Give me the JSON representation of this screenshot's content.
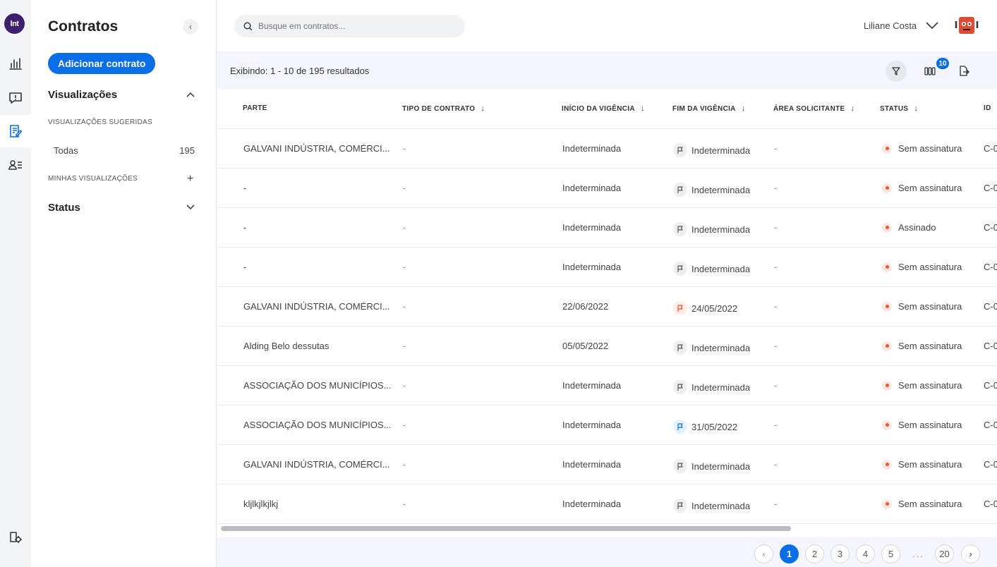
{
  "app": {
    "logo_text": "lnt"
  },
  "rail": {
    "items": [
      "chart-icon",
      "alert-icon",
      "contracts-icon",
      "users-icon",
      "settings-icon"
    ]
  },
  "sidebar": {
    "title": "Contratos",
    "add_button": "Adicionar contrato",
    "visualizacoes": "Visualizações",
    "sugeridas": "VISUALIZAÇÕES SUGERIDAS",
    "todas_label": "Todas",
    "todas_count": "195",
    "minhas": "MINHAS VISUALIZAÇÕES",
    "status": "Status"
  },
  "header": {
    "search_placeholder": "Busque em contratos...",
    "user_name": "Liliane Costa"
  },
  "toolbar": {
    "results_text": "Exibindo: 1 - 10 de 195 resultados",
    "columns_badge": "10"
  },
  "table": {
    "headers": [
      "PARTE",
      "TIPO DE CONTRATO",
      "INÍCIO DA VIGÊNCIA",
      "FIM DA VIGÊNCIA",
      "ÁREA SOLICITANTE",
      "STATUS",
      "ID"
    ],
    "rows": [
      {
        "parte": "GALVANI INDÚSTRIA, COMÉRCI...",
        "tipo": "-",
        "inicio": "Indeterminada",
        "fim": "Indeterminada",
        "fim_flag": "gray",
        "area": "-",
        "status": "Sem assinatura",
        "id": "C-0"
      },
      {
        "parte": "-",
        "tipo": "-",
        "inicio": "Indeterminada",
        "fim": "Indeterminada",
        "fim_flag": "gray",
        "area": "-",
        "status": "Sem assinatura",
        "id": "C-0"
      },
      {
        "parte": "-",
        "tipo": "-",
        "inicio": "Indeterminada",
        "fim": "Indeterminada",
        "fim_flag": "gray",
        "area": "-",
        "status": "Assinado",
        "id": "C-0"
      },
      {
        "parte": "-",
        "tipo": "-",
        "inicio": "Indeterminada",
        "fim": "Indeterminada",
        "fim_flag": "gray",
        "area": "-",
        "status": "Sem assinatura",
        "id": "C-0"
      },
      {
        "parte": "GALVANI INDÚSTRIA, COMÉRCI...",
        "tipo": "-",
        "inicio": "22/06/2022",
        "fim": "24/05/2022",
        "fim_flag": "red",
        "area": "-",
        "status": "Sem assinatura",
        "id": "C-0"
      },
      {
        "parte": "Alding Belo dessutas",
        "tipo": "-",
        "inicio": "05/05/2022",
        "fim": "Indeterminada",
        "fim_flag": "gray",
        "area": "-",
        "status": "Sem assinatura",
        "id": "C-0"
      },
      {
        "parte": "ASSOCIAÇÃO DOS MUNICÍPIOS...",
        "tipo": "-",
        "inicio": "Indeterminada",
        "fim": "Indeterminada",
        "fim_flag": "gray",
        "area": "-",
        "status": "Sem assinatura",
        "id": "C-0"
      },
      {
        "parte": "ASSOCIAÇÃO DOS MUNICÍPIOS...",
        "tipo": "-",
        "inicio": "Indeterminada",
        "fim": "31/05/2022",
        "fim_flag": "blue",
        "area": "-",
        "status": "Sem assinatura",
        "id": "C-0"
      },
      {
        "parte": "GALVANI INDÚSTRIA, COMÉRCI...",
        "tipo": "-",
        "inicio": "Indeterminada",
        "fim": "Indeterminada",
        "fim_flag": "gray",
        "area": "-",
        "status": "Sem assinatura",
        "id": "C-0"
      },
      {
        "parte": "kljlkjlkjlkj",
        "tipo": "-",
        "inicio": "Indeterminada",
        "fim": "Indeterminada",
        "fim_flag": "gray",
        "area": "-",
        "status": "Sem assinatura",
        "id": "C-0"
      }
    ]
  },
  "pagination": {
    "pages": [
      "1",
      "2",
      "3",
      "4",
      "5",
      "...",
      "20"
    ],
    "current": "1"
  },
  "colors": {
    "accent": "#0a6fe6",
    "status_dot": "#e8572f",
    "flag_red": "#e8572f",
    "flag_blue": "#0a6fe6"
  }
}
